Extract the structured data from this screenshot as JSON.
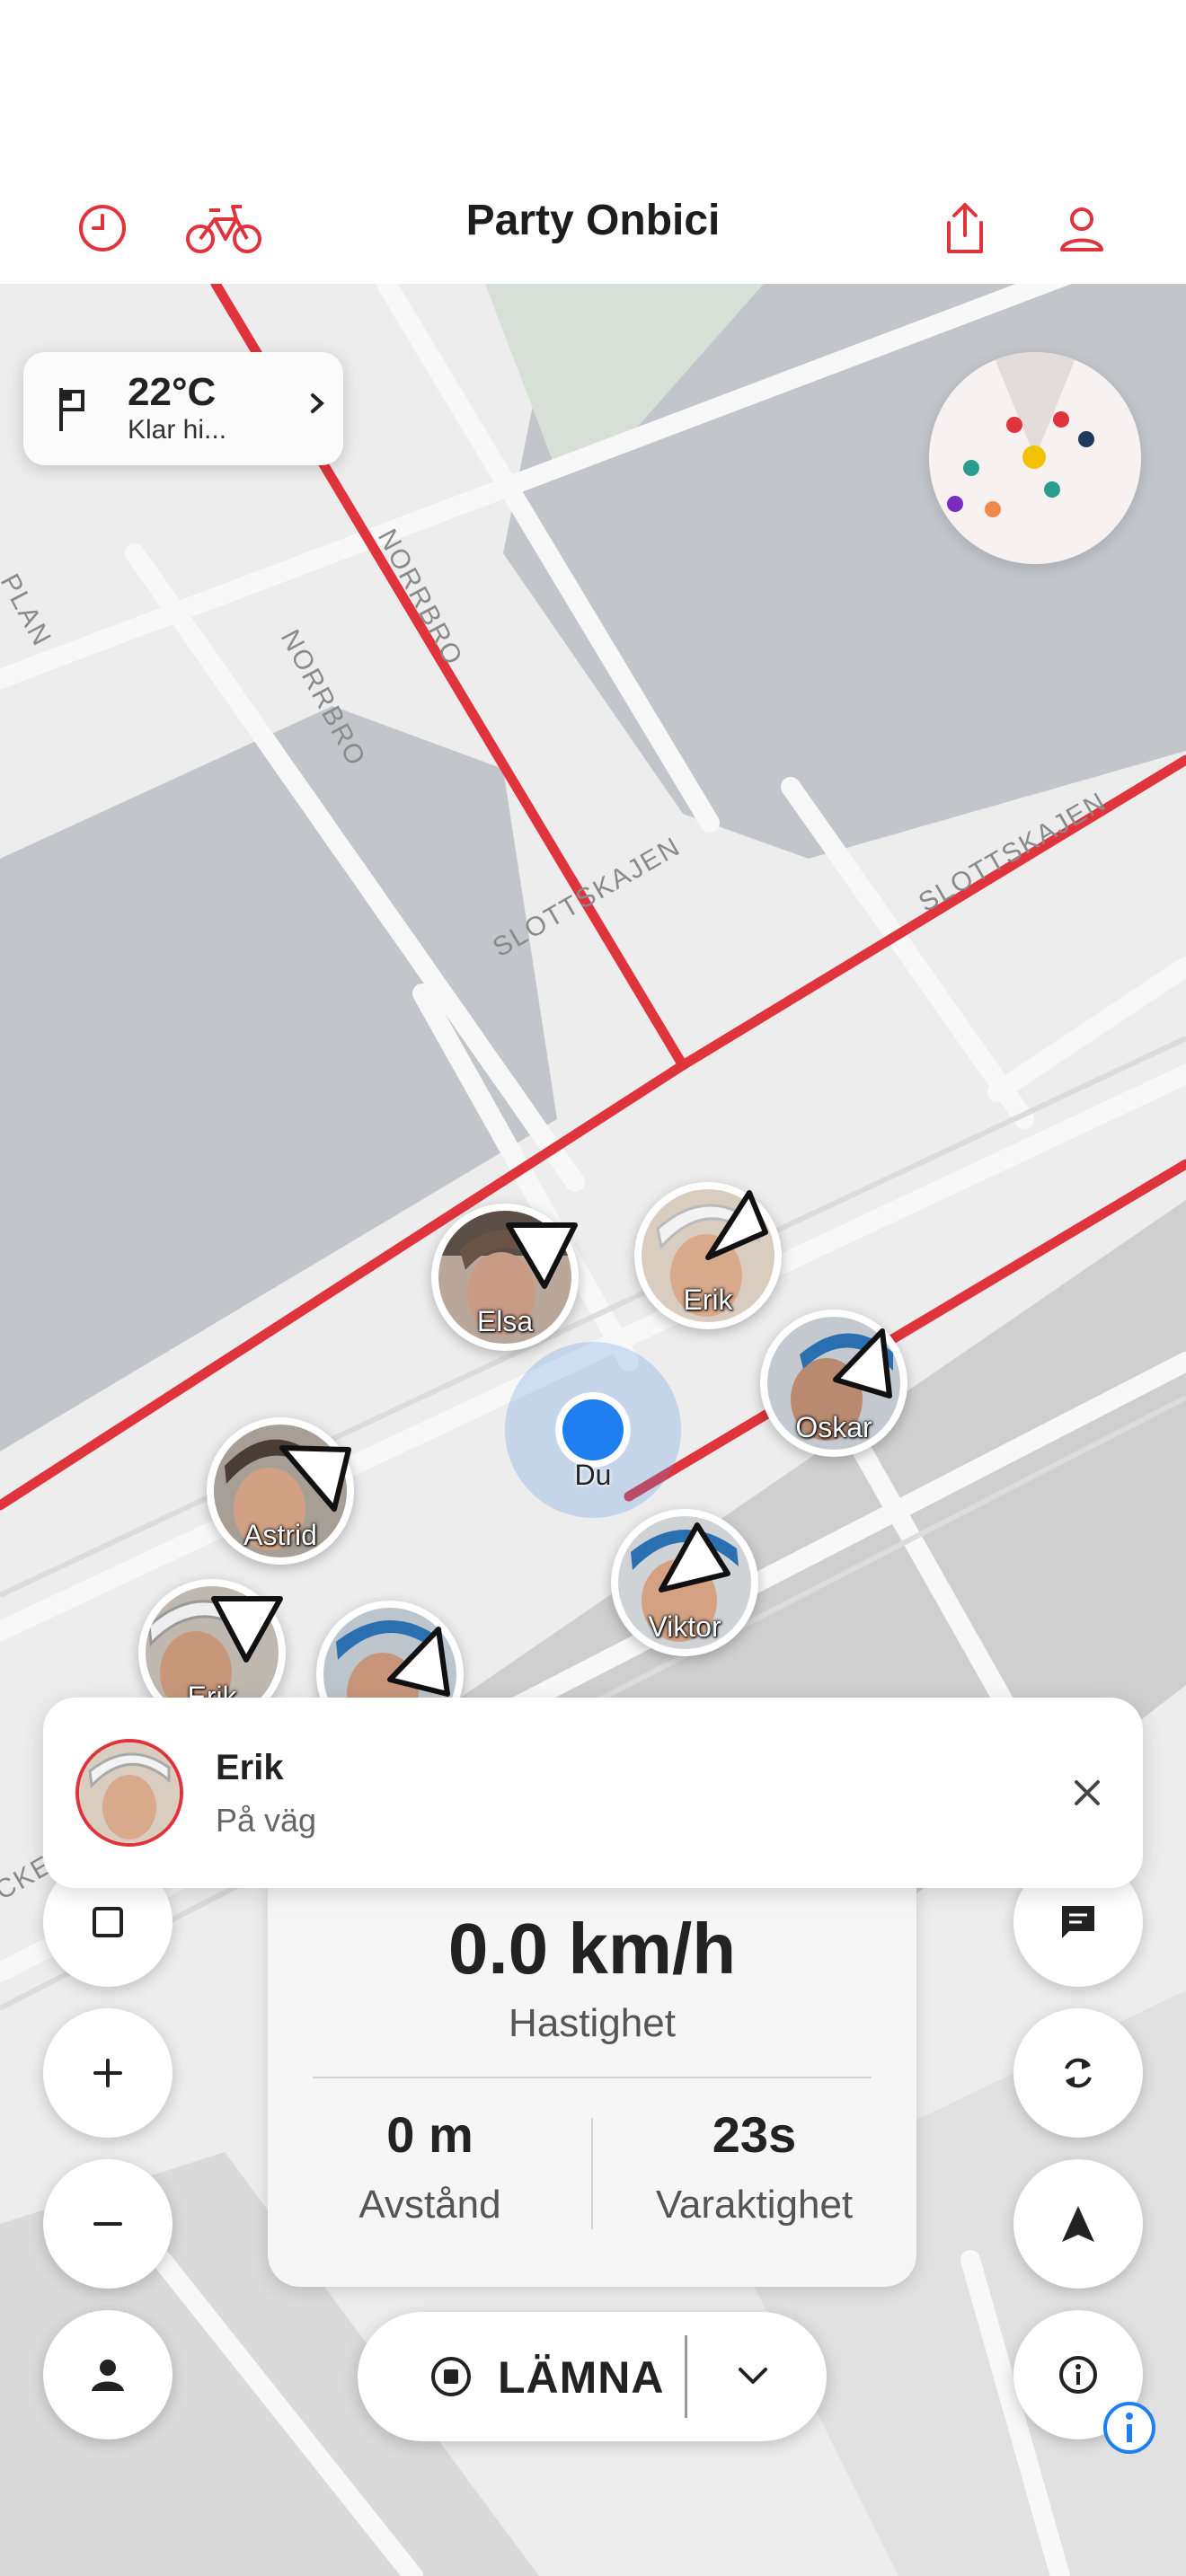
{
  "header": {
    "title": "Party Onbici",
    "accent": "#e0343c"
  },
  "map": {
    "streets": [
      "NORRBRO",
      "NORRBRO",
      "SLOTTSKAJEN",
      "SLOTTSKAJEN",
      "PLAN",
      "CKE"
    ]
  },
  "weather": {
    "temp": "22°C",
    "desc": "Klar hi..."
  },
  "riders": [
    {
      "name": "Elsa"
    },
    {
      "name": "Erik"
    },
    {
      "name": "Oskar"
    },
    {
      "name": "Astrid"
    },
    {
      "name": "Viktor"
    },
    {
      "name": "Erik"
    },
    {
      "name": ""
    }
  ],
  "me": {
    "label": "Du"
  },
  "notification": {
    "name": "Erik",
    "status": "På väg"
  },
  "stats": {
    "speed": "0.0 km/h",
    "speed_label": "Hastighet",
    "distance": "0 m",
    "distance_label": "Avstånd",
    "duration": "23s",
    "duration_label": "Varaktighet"
  },
  "leave_button": {
    "label": "LÄMNA"
  },
  "radar_colors": [
    "#e0343c",
    "#e0343c",
    "#1e3a5f",
    "#f2c200",
    "#2a9d8f",
    "#2a9d8f",
    "#7b2cbf",
    "#f08a4b"
  ]
}
